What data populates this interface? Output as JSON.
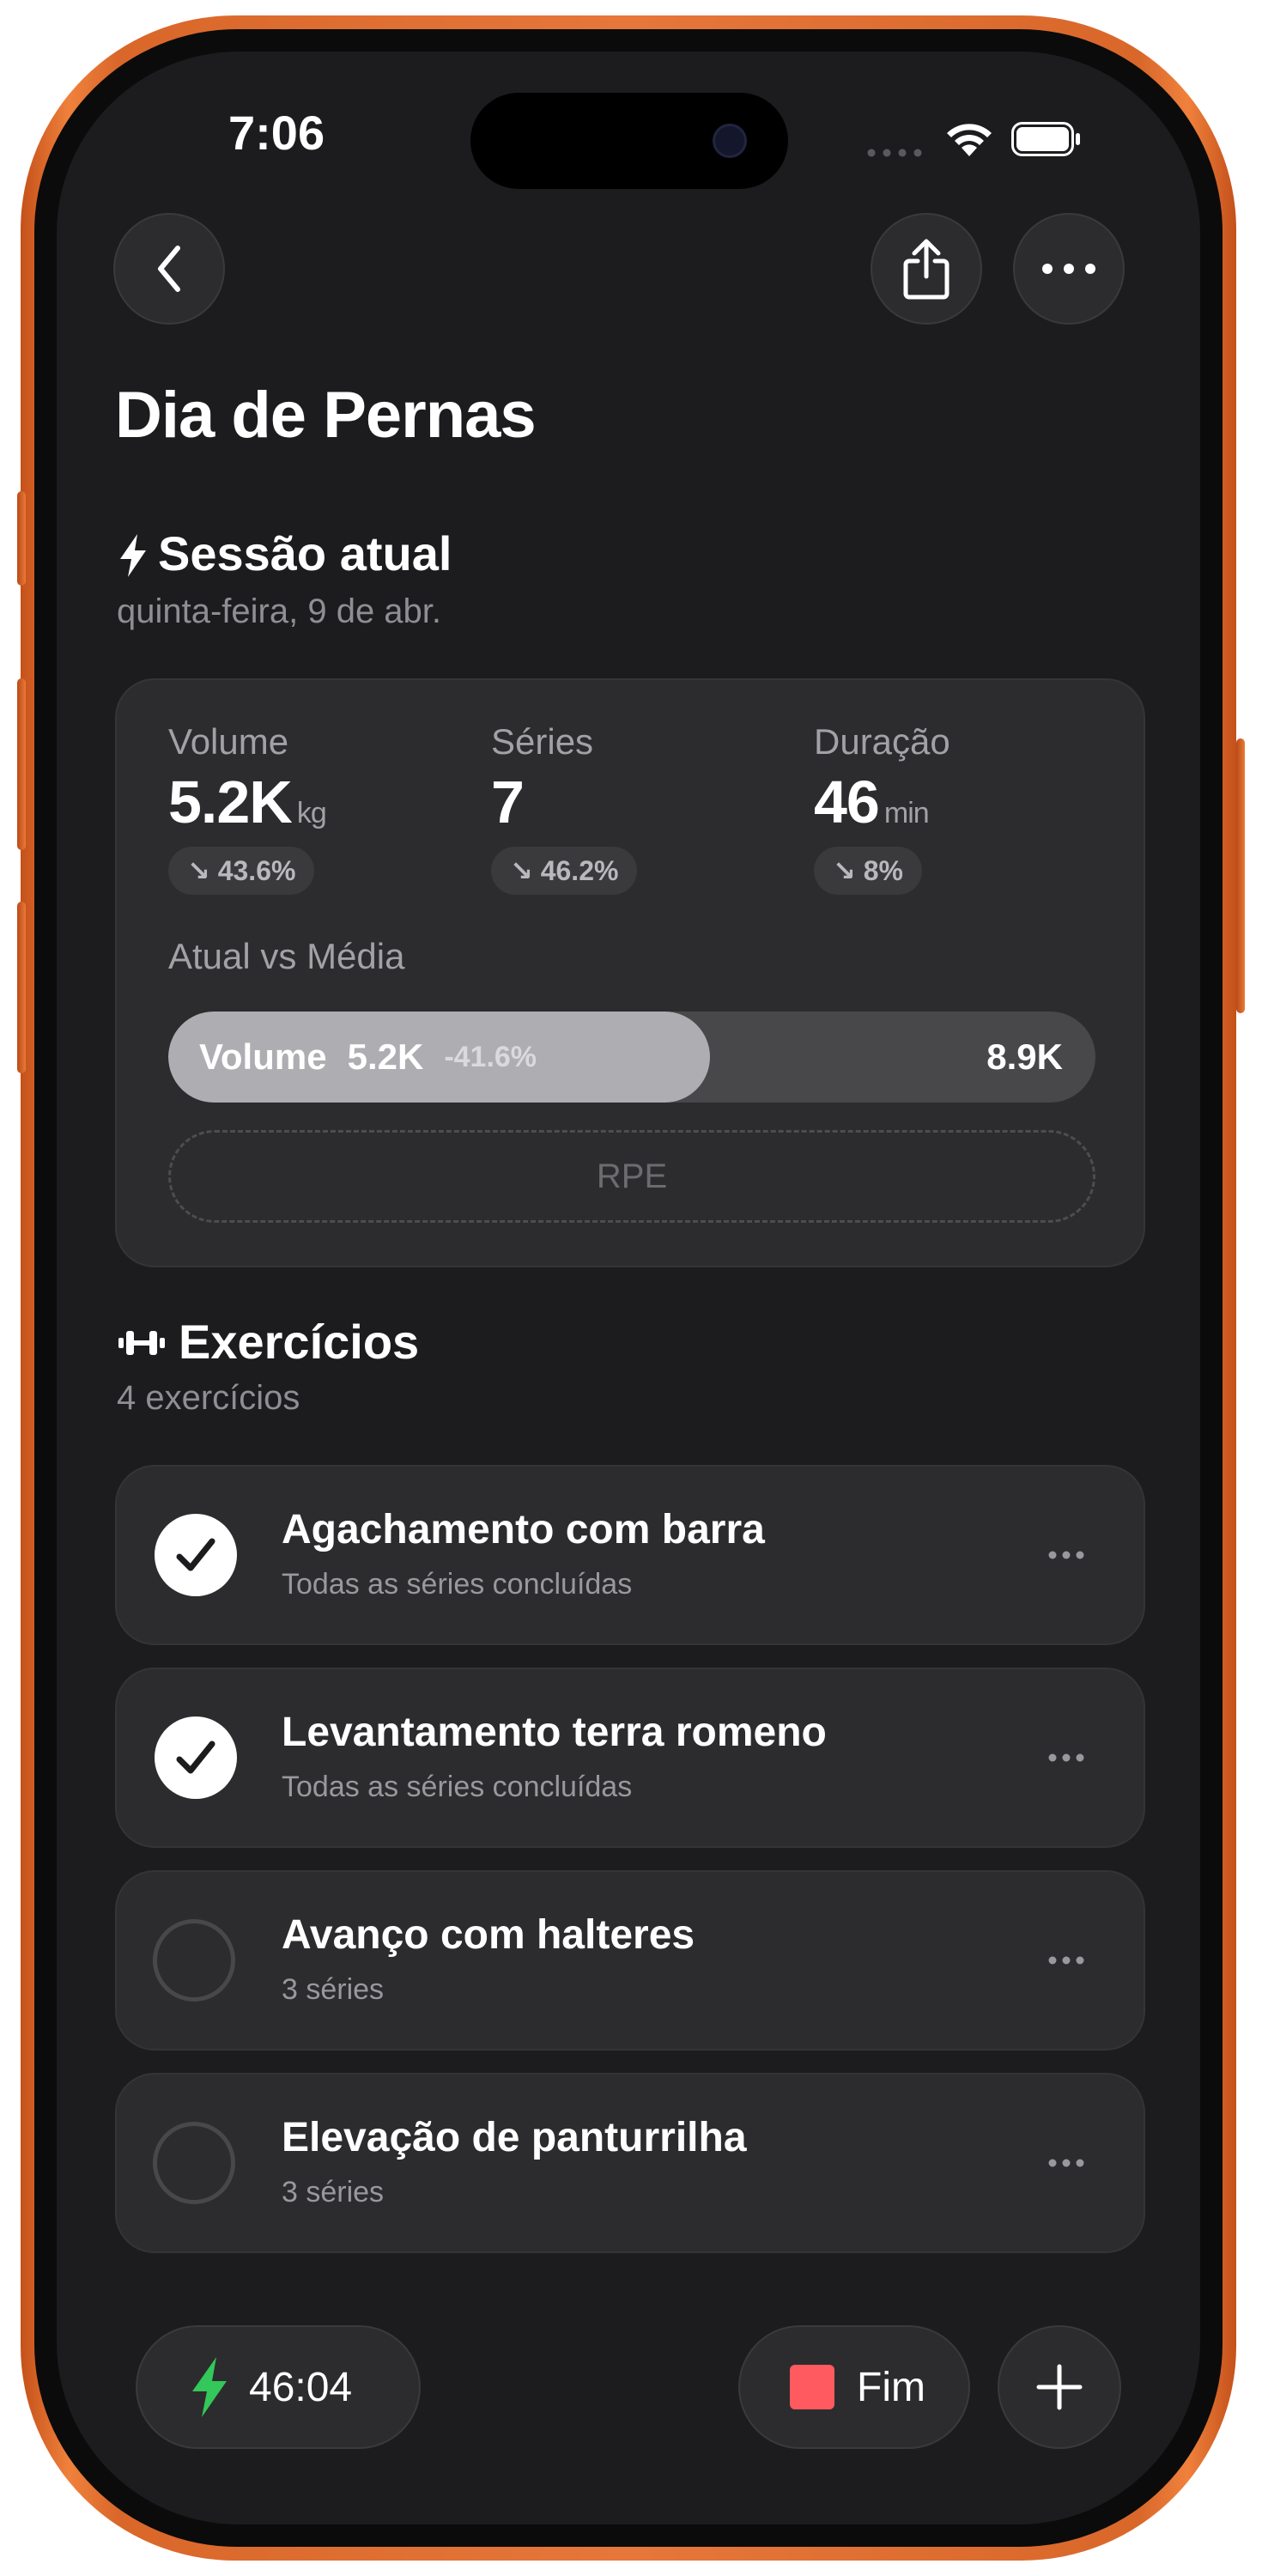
{
  "status_bar": {
    "time": "7:06"
  },
  "header": {
    "title": "Dia de Pernas"
  },
  "session": {
    "heading": "Sessão atual",
    "date": "quinta-feira, 9 de abr.",
    "stats": [
      {
        "label": "Volume",
        "value": "5.2K",
        "unit": "kg",
        "change": "↘ 43.6%"
      },
      {
        "label": "Séries",
        "value": "7",
        "unit": "",
        "change": "↘ 46.2%"
      },
      {
        "label": "Duração",
        "value": "46",
        "unit": "min",
        "change": "↘ 8%"
      }
    ],
    "comparison_label": "Atual vs Média",
    "bar": {
      "label": "Volume",
      "current": "5.2K",
      "delta": "-41.6%",
      "average": "8.9K",
      "fill_fraction": 0.584
    },
    "rpe_label": "RPE"
  },
  "exercises": {
    "heading": "Exercícios",
    "count": "4 exercícios",
    "items": [
      {
        "name": "Agachamento com barra",
        "subtitle": "Todas as séries concluídas",
        "done": true
      },
      {
        "name": "Levantamento terra romeno",
        "subtitle": "Todas as séries concluídas",
        "done": true
      },
      {
        "name": "Avanço com halteres",
        "subtitle": "3 séries",
        "done": false
      },
      {
        "name": "Elevação de panturrilha",
        "subtitle": "3 séries",
        "done": false
      }
    ]
  },
  "bottom_bar": {
    "timer": "46:04",
    "finish_label": "Fim"
  },
  "colors": {
    "accent_green": "#34c759",
    "stop_red": "#ff453a",
    "frame_orange": "#e6763a"
  },
  "icons": [
    "back-chevron-icon",
    "share-icon",
    "more-icon",
    "bolt-icon",
    "dumbbell-icon",
    "checkmark-icon",
    "stop-icon",
    "plus-icon",
    "wifi-icon",
    "battery-icon"
  ]
}
